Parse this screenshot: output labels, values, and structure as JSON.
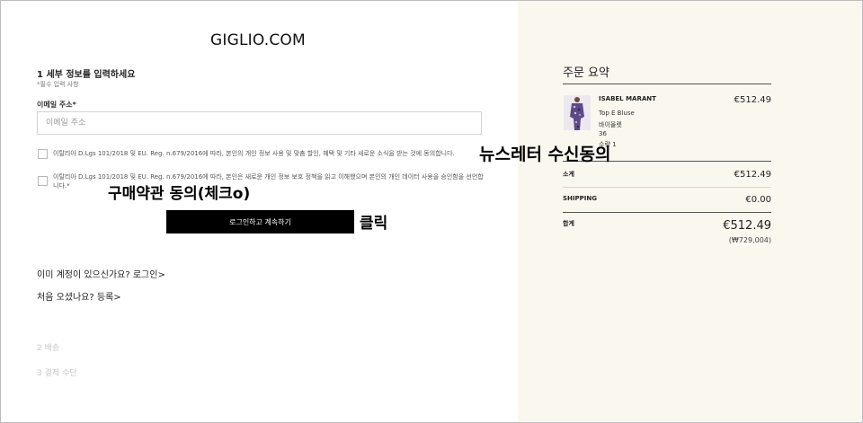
{
  "checkout": {
    "logo": "GIGLIO.COM",
    "step1_title": "1 세부 정보를 입력하세요",
    "required_note": "*필수 입력 사항",
    "email_label": "이메일 주소*",
    "email_placeholder": "이메일 주소",
    "email_value": "",
    "consent_newsletter": "이탈리아 D.Lgs 101/2018 및 EU. Reg. n.679/2016에 따라, 본인의 개인 정보 사용 및 맞춤 할인, 혜택 및 기타 새로운 소식을 받는 것에 동의합니다.",
    "consent_privacy": "이탈리아 D.Lgs 101/2018 및 EU. Reg. n.679/2016에 따라, 본인은 새로운 개인 정보 보호 정책을 읽고 이해했으며 본인의 개인 데이터 사용을 승인함을 선언합니다.*",
    "newsletter_checked": false,
    "privacy_checked": false,
    "login_continue_label": "로그인하고 계속하기",
    "existing_account_text": "이미 계정이 있으신가요?",
    "login_link": "로그인",
    "first_time_text": "처음 오셨나요?",
    "register_link": "등록",
    "chevron": ">",
    "step2_title": "2 배송",
    "step3_title": "3 결제 수단"
  },
  "summary": {
    "title": "주문 요약",
    "item": {
      "brand": "ISABEL MARANT",
      "price": "€512.49",
      "name": "Top E Bluse",
      "color": "바이올렛",
      "size": "36",
      "quantity": "수량 1"
    },
    "subtotal_label": "소계",
    "subtotal_value": "€512.49",
    "shipping_label": "SHIPPING",
    "shipping_value": "€0.00",
    "total_label": "합계",
    "total_value": "€512.49",
    "total_krw": "(₩729,004)"
  },
  "annotations": {
    "newsletter": "뉴스레터 수신동의",
    "terms": "구매약관 동의(체크o)",
    "click": "클릭"
  },
  "colors": {
    "summary_bg": "#faf7ef",
    "button_bg": "#000000"
  }
}
